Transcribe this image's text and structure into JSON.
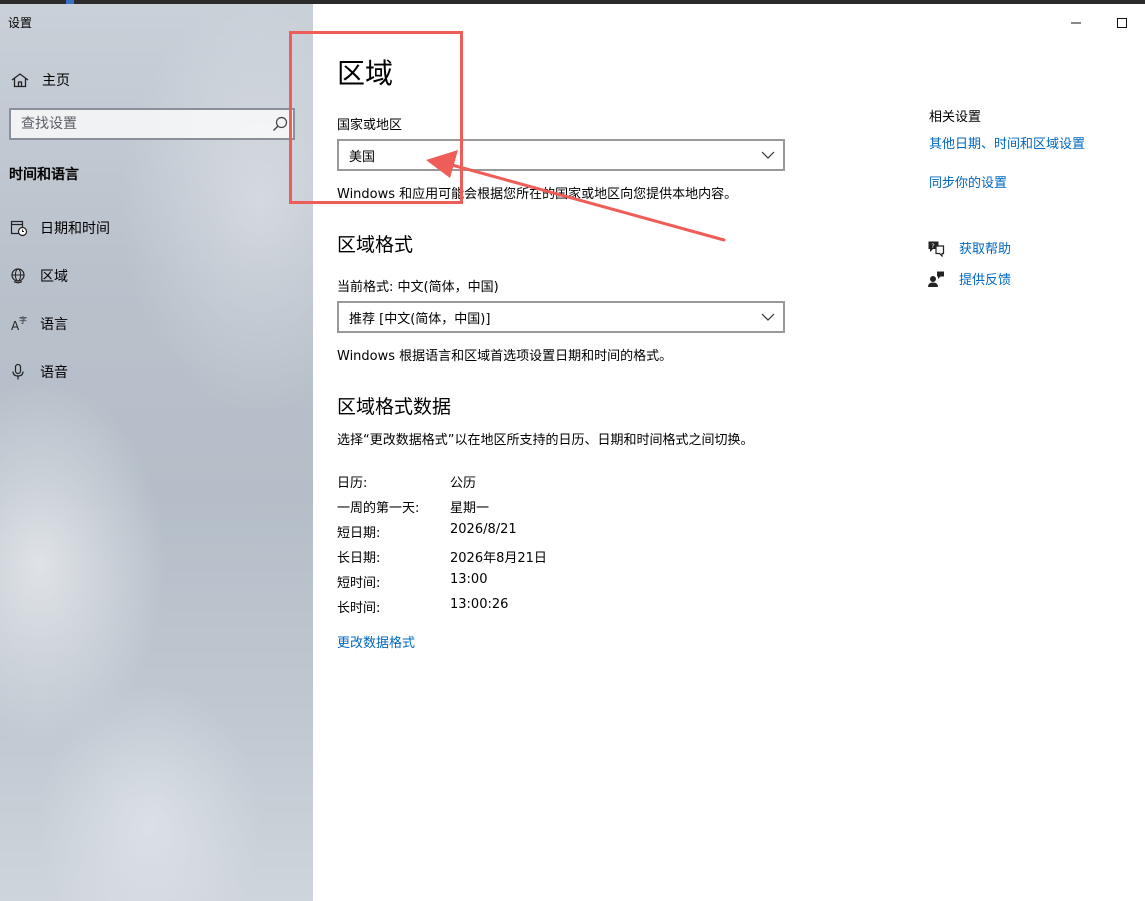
{
  "app": {
    "title": "设置"
  },
  "sidebar": {
    "home_label": "主页",
    "search": {
      "placeholder": "查找设置",
      "value": ""
    },
    "section_label": "时间和语言",
    "items": [
      {
        "label": "日期和时间",
        "icon": "calendar-clock-icon"
      },
      {
        "label": "区域",
        "icon": "globe-icon"
      },
      {
        "label": "语言",
        "icon": "language-icon"
      },
      {
        "label": "语音",
        "icon": "microphone-icon"
      }
    ]
  },
  "window": {
    "minimize_icon": "minimize-icon",
    "maximize_icon": "maximize-icon"
  },
  "main": {
    "title": "区域",
    "country": {
      "label": "国家或地区",
      "selected": "美国",
      "desc": "Windows 和应用可能会根据您所在的国家或地区向您提供本地内容。"
    },
    "format": {
      "heading": "区域格式",
      "current_label": "当前格式: 中文(简体，中国)",
      "selected": "推荐 [中文(简体，中国)]",
      "desc": "Windows 根据语言和区域首选项设置日期和时间的格式。"
    },
    "format_data": {
      "heading": "区域格式数据",
      "desc": "选择“更改数据格式”以在地区所支持的日历、日期和时间格式之间切换。",
      "rows": [
        {
          "key": "日历:",
          "value": "公历"
        },
        {
          "key": "一周的第一天:",
          "value": "星期一"
        },
        {
          "key": "短日期:",
          "value": "2026/8/21"
        },
        {
          "key": "长日期:",
          "value": "2026年8月21日"
        },
        {
          "key": "短时间:",
          "value": "13:00"
        },
        {
          "key": "长时间:",
          "value": "13:00:26"
        }
      ],
      "change_link": "更改数据格式"
    }
  },
  "related": {
    "title": "相关设置",
    "links": [
      "其他日期、时间和区域设置",
      "同步你的设置"
    ],
    "help": "获取帮助",
    "feedback": "提供反馈"
  },
  "colors": {
    "accent": "#0067c0",
    "annotation": "#ee5d58"
  }
}
